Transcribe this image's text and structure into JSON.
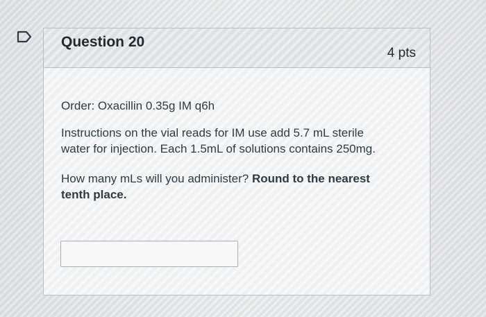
{
  "question": {
    "title": "Question 20",
    "points": "4 pts",
    "order": "Order: Oxacillin 0.35g IM q6h",
    "instructions": "Instructions on the vial reads for IM use add 5.7 mL sterile water for injection. Each 1.5mL of solutions contains 250mg.",
    "prompt": "How many mLs will you administer?",
    "emphasis": "Round to the nearest tenth place.",
    "answer_value": ""
  },
  "icons": {
    "flag": "flag-icon"
  },
  "colors": {
    "accent": "#2d3b45",
    "card_border": "#b8bec4"
  }
}
